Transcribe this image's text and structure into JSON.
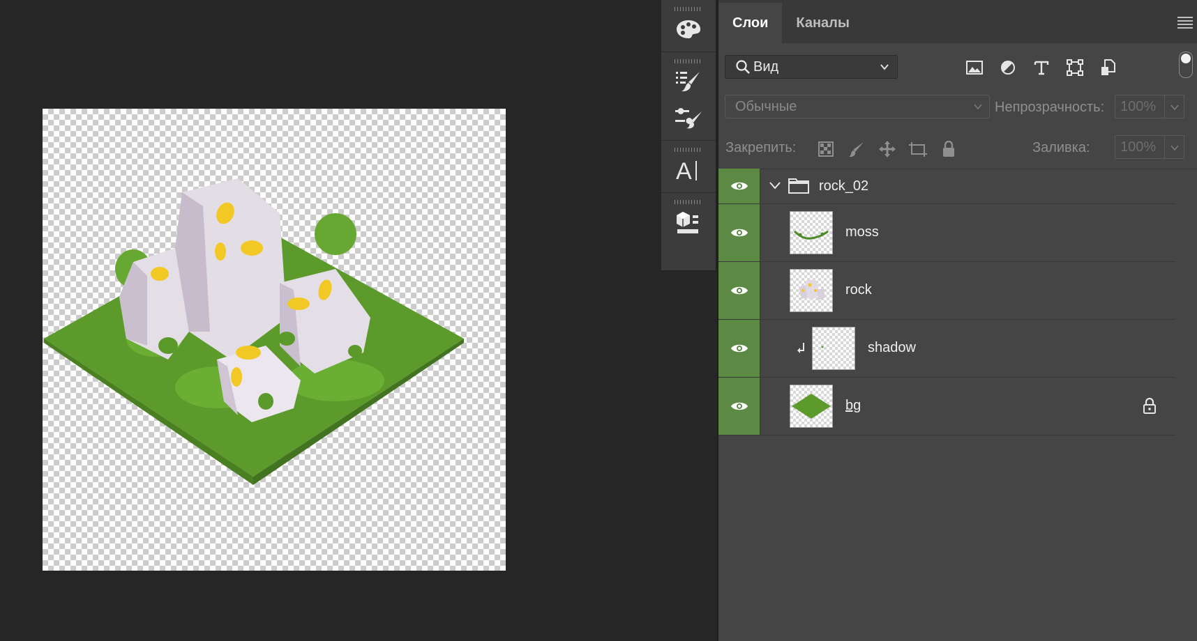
{
  "tabs": [
    {
      "label": "Слои",
      "active": true
    },
    {
      "label": "Каналы",
      "active": false
    }
  ],
  "filter": {
    "search_icon": "search-icon",
    "label": "Вид"
  },
  "filter_icons": [
    "image-filter-icon",
    "adjustment-filter-icon",
    "type-filter-icon",
    "shape-filter-icon",
    "smart-object-filter-icon"
  ],
  "blend_mode": "Обычные",
  "opacity": {
    "label": "Непрозрачность:",
    "value": "100%"
  },
  "lock": {
    "label": "Закрепить:",
    "icons": [
      "lock-transparent-pixels-icon",
      "lock-image-pixels-icon",
      "lock-position-icon",
      "lock-artboard-icon",
      "lock-all-icon"
    ]
  },
  "fill": {
    "label": "Заливка:",
    "value": "100%"
  },
  "layers": [
    {
      "name": "rock_02",
      "kind": "group",
      "visible": true,
      "expanded": true
    },
    {
      "name": "moss",
      "kind": "pixel",
      "visible": true
    },
    {
      "name": "rock",
      "kind": "pixel",
      "visible": true
    },
    {
      "name": "shadow",
      "kind": "pixel",
      "visible": true,
      "clipped": true
    },
    {
      "name": "bg",
      "kind": "pixel",
      "visible": true,
      "locked": true
    }
  ],
  "tools": [
    "swatches-icon",
    "brush-presets-icon",
    "brush-settings-icon",
    "character-styles-icon",
    "3d-materials-icon"
  ],
  "colors": {
    "accent_visibility": "#5c8a45",
    "grass": "#5f9a2e",
    "rock": "#dcd6de",
    "petal": "#f2c824"
  }
}
